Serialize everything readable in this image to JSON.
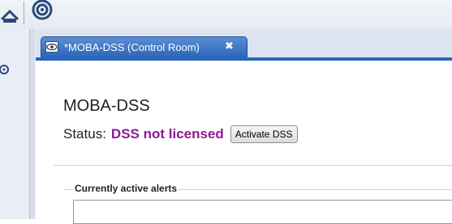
{
  "tab": {
    "title": "*MOBA-DSS (Control Room)",
    "close_glyph": "✖"
  },
  "view": {
    "title": "MOBA-DSS",
    "status_label": "Status:",
    "status_value": "DSS not licensed",
    "activate_button": "Activate DSS"
  },
  "alerts": {
    "legend": "Currently active alerts"
  },
  "colors": {
    "tab_active": "#2c66b9",
    "status_value": "#8b1a96"
  },
  "icons": {
    "toolbar_left": "home-network-icon",
    "toolbar_radar": "radar-icon",
    "tab": "eye-icon"
  }
}
